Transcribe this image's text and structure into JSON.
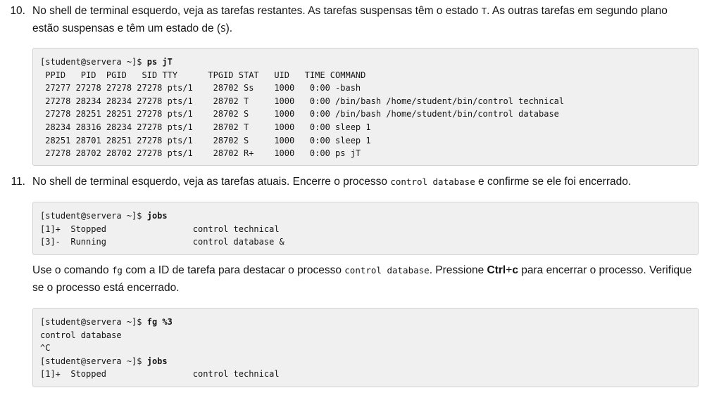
{
  "step10": {
    "number": "10.",
    "text_a": "No shell de terminal esquerdo, veja as tarefas restantes. As tarefas suspensas têm o estado ",
    "code_a": "T",
    "text_b": ". As outras tarefas em segundo plano estão suspensas e têm um estado de (",
    "code_b": "S",
    "text_c": ").",
    "terminal": {
      "prompt": "[student@servera ~]$ ",
      "command": "ps jT",
      "lines": [
        " PPID   PID  PGID   SID TTY      TPGID STAT   UID   TIME COMMAND",
        " 27277 27278 27278 27278 pts/1    28702 Ss    1000   0:00 -bash",
        " 27278 28234 28234 27278 pts/1    28702 T     1000   0:00 /bin/bash /home/student/bin/control technical",
        " 27278 28251 28251 27278 pts/1    28702 S     1000   0:00 /bin/bash /home/student/bin/control database",
        " 28234 28316 28234 27278 pts/1    28702 T     1000   0:00 sleep 1",
        " 28251 28701 28251 27278 pts/1    28702 S     1000   0:00 sleep 1",
        " 27278 28702 28702 27278 pts/1    28702 R+    1000   0:00 ps jT"
      ]
    }
  },
  "step11": {
    "number": "11.",
    "text_a": "No shell de terminal esquerdo, veja as tarefas atuais. Encerre o processo ",
    "code_a": "control database",
    "text_b": " e confirme se ele foi encerrado.",
    "terminal1": {
      "prompt": "[student@servera ~]$ ",
      "command": "jobs",
      "lines": [
        "[1]+  Stopped                 control technical",
        "[3]-  Running                 control database &"
      ]
    },
    "para2": {
      "text_a": "Use o comando ",
      "code_a": "fg",
      "text_b": " com a ID de tarefa para destacar o processo ",
      "code_b": "control database",
      "text_c": ". Pressione ",
      "key_ctrl": "Ctrl",
      "key_plus": "+",
      "key_c": "c",
      "text_d": " para encerrar o processo. Verifique se o processo está encerrado."
    },
    "terminal2": {
      "prompt1": "[student@servera ~]$ ",
      "command1": "fg %3",
      "out1": "control database",
      "out2": "^C",
      "prompt2": "[student@servera ~]$ ",
      "command2": "jobs",
      "out3": "[1]+  Stopped                 control technical"
    }
  }
}
